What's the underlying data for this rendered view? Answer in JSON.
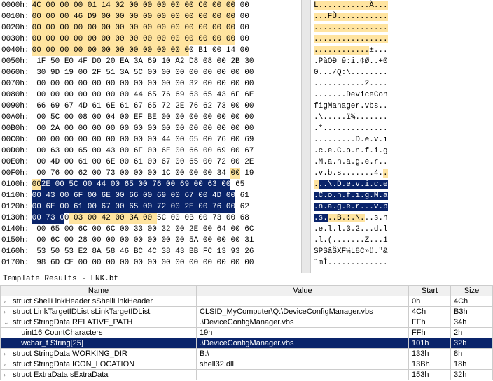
{
  "hex": {
    "rows": [
      {
        "offset": "0000h:",
        "bytes": "4C 00 00 00 01 14 02 00 00 00 00 00 C0 00 00 00",
        "ascii": "L...........À...",
        "yhex": [
          0,
          43
        ],
        "yasc": [
          0,
          15
        ]
      },
      {
        "offset": "0010h:",
        "bytes": "00 00 00 46 D9 00 00 00 00 00 00 00 00 00 00 00",
        "ascii": "...FÙ...........",
        "yhex": [
          0,
          43
        ],
        "yasc": [
          0,
          15
        ]
      },
      {
        "offset": "0020h:",
        "bytes": "00 00 00 00 00 00 00 00 00 00 00 00 00 00 00 00",
        "ascii": "................",
        "yhex": [
          0,
          43
        ],
        "yasc": [
          0,
          15
        ]
      },
      {
        "offset": "0030h:",
        "bytes": "00 00 00 00 00 00 00 00 00 00 00 00 00 00 00 00",
        "ascii": "................",
        "yhex": [
          0,
          43
        ],
        "yasc": [
          0,
          15
        ]
      },
      {
        "offset": "0040h:",
        "bytes": "00 00 00 00 00 00 00 00 00 00 00 00 B1 00 14 00",
        "ascii": "............±...",
        "yhex": [
          0,
          33
        ],
        "yasc": [
          0,
          11
        ]
      },
      {
        "offset": "0050h:",
        "bytes": "1F 50 E0 4F D0 20 EA 3A 69 10 A2 D8 08 00 2B 30",
        "ascii": ".PàOÐ ê:i.¢Ø..+0"
      },
      {
        "offset": "0060h:",
        "bytes": "30 9D 19 00 2F 51 3A 5C 00 00 00 00 00 00 00 00",
        "ascii": "0.../Q:\\........"
      },
      {
        "offset": "0070h:",
        "bytes": "00 00 00 00 00 00 00 00 00 00 00 32 00 00 00 00",
        "ascii": "...........2...."
      },
      {
        "offset": "0080h:",
        "bytes": "00 00 00 00 00 00 00 44 65 76 69 63 65 43 6F 6E",
        "ascii": ".......DeviceCon"
      },
      {
        "offset": "0090h:",
        "bytes": "66 69 67 4D 61 6E 61 67 65 72 2E 76 62 73 00 00",
        "ascii": "figManager.vbs.."
      },
      {
        "offset": "00A0h:",
        "bytes": "00 5C 00 08 00 04 00 EF BE 00 00 00 00 00 00 00",
        "ascii": ".\\.....ï¾......."
      },
      {
        "offset": "00B0h:",
        "bytes": "00 2A 00 00 00 00 00 00 00 00 00 00 00 00 00 00",
        "ascii": ".*.............."
      },
      {
        "offset": "00C0h:",
        "bytes": "00 00 00 00 00 00 00 00 00 44 00 65 00 76 00 69",
        "ascii": ".........D.e.v.i"
      },
      {
        "offset": "00D0h:",
        "bytes": "00 63 00 65 00 43 00 6F 00 6E 00 66 00 69 00 67",
        "ascii": ".c.e.C.o.n.f.i.g"
      },
      {
        "offset": "00E0h:",
        "bytes": "00 4D 00 61 00 6E 00 61 00 67 00 65 00 72 00 2E",
        "ascii": ".M.a.n.a.g.e.r.."
      },
      {
        "offset": "00F0h:",
        "bytes": "00 76 00 62 00 73 00 00 00 1C 00 00 00 34 00 19",
        "ascii": ".v.b.s.......4..",
        "yhex": [
          42,
          43
        ],
        "yasc": [
          15,
          15
        ]
      },
      {
        "offset": "0100h:",
        "bytes": "00 2E 00 5C 00 44 00 65 00 76 00 69 00 63 00 65",
        "ascii": "...\\.D.e.v.i.c.e",
        "yhex": [
          0,
          1
        ],
        "yasc": [
          0,
          0
        ],
        "bhex": [
          3,
          43
        ],
        "basc": [
          1,
          15
        ]
      },
      {
        "offset": "0110h:",
        "bytes": "00 43 00 6F 00 6E 00 66 00 69 00 67 00 4D 00 61",
        "ascii": ".C.o.n.f.i.g.M.a",
        "bhex": [
          0,
          43
        ],
        "basc": [
          0,
          15
        ]
      },
      {
        "offset": "0120h:",
        "bytes": "00 6E 00 61 00 67 00 65 00 72 00 2E 00 76 00 62",
        "ascii": ".n.a.g.e.r...v.b",
        "bhex": [
          0,
          43
        ],
        "basc": [
          0,
          15
        ]
      },
      {
        "offset": "0130h:",
        "bytes": "00 73 00 03 00 42 00 3A 00 5C 00 0B 00 73 00 68",
        "ascii": ".s...B.:.\\...s.h",
        "bhex": [
          0,
          6
        ],
        "basc": [
          0,
          2
        ],
        "yhex": [
          8,
          26
        ],
        "yasc": [
          3,
          10
        ]
      },
      {
        "offset": "0140h:",
        "bytes": "00 65 00 6C 00 6C 00 33 00 32 00 2E 00 64 00 6C",
        "ascii": ".e.l.l.3.2...d.l"
      },
      {
        "offset": "0150h:",
        "bytes": "00 6C 00 28 00 00 00 00 00 00 00 5A 00 00 00 31",
        "ascii": ".l.(.......Z...1"
      },
      {
        "offset": "0160h:",
        "bytes": "53 50 53 E2 8A 58 46 BC 4C 38 43 BB FC 13 93 26",
        "ascii": "SPSâŠXF¼L8C»ü.\"&"
      },
      {
        "offset": "0170h:",
        "bytes": "98 6D CE 00 00 00 00 00 00 00 00 00 00 00 00 00",
        "ascii": "˜mÎ............."
      }
    ]
  },
  "template": {
    "title": "Template Results - LNK.bt",
    "headers": {
      "name": "Name",
      "value": "Value",
      "start": "Start",
      "size": "Size"
    },
    "rows": [
      {
        "indent": 0,
        "chev": ">",
        "name": "struct ShellLinkHeader sShellLinkHeader",
        "value": "",
        "start": "0h",
        "size": "4Ch"
      },
      {
        "indent": 0,
        "chev": ">",
        "name": "struct LinkTargetIDList sLinkTargetIDList",
        "value": "CLSID_MyComputer\\Q:\\DeviceConfigManager.vbs",
        "start": "4Ch",
        "size": "B3h"
      },
      {
        "indent": 0,
        "chev": "v",
        "name": "struct StringData RELATIVE_PATH",
        "value": ".\\DeviceConfigManager.vbs",
        "start": "FFh",
        "size": "34h"
      },
      {
        "indent": 1,
        "chev": "",
        "name": "uint16 CountCharacters",
        "value": "19h",
        "start": "FFh",
        "size": "2h"
      },
      {
        "indent": 1,
        "chev": "",
        "name": "wchar_t String[25]",
        "value": ".\\DeviceConfigManager.vbs",
        "start": "101h",
        "size": "32h",
        "selected": true
      },
      {
        "indent": 0,
        "chev": ">",
        "name": "struct StringData WORKING_DIR",
        "value": "B:\\",
        "start": "133h",
        "size": "8h"
      },
      {
        "indent": 0,
        "chev": ">",
        "name": "struct StringData ICON_LOCATION",
        "value": "shell32.dll",
        "start": "13Bh",
        "size": "18h"
      },
      {
        "indent": 0,
        "chev": ">",
        "name": "struct ExtraData sExtraData",
        "value": "",
        "start": "153h",
        "size": "32h"
      }
    ]
  }
}
